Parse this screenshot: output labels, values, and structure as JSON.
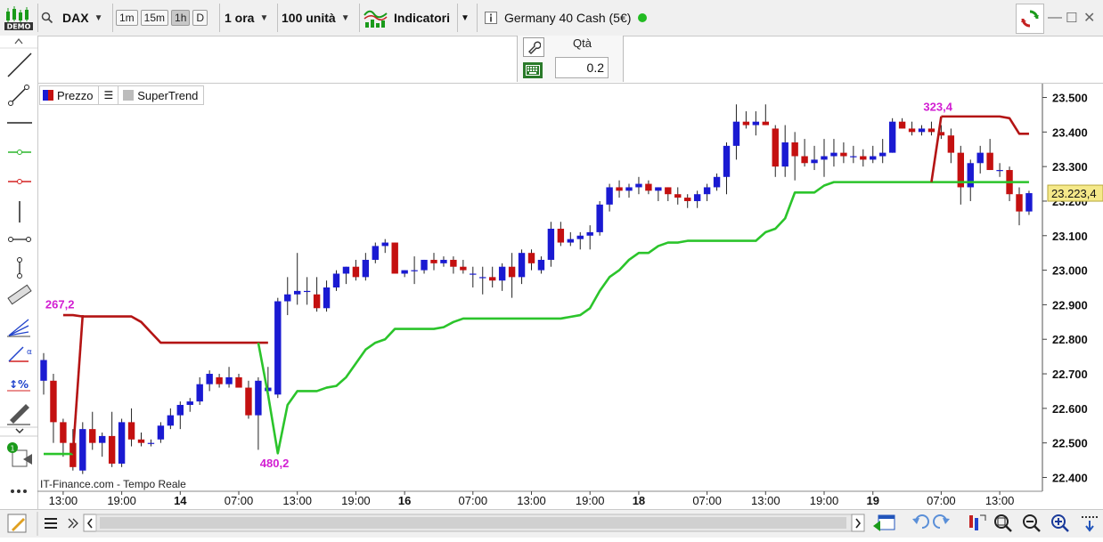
{
  "toolbar": {
    "demo_badge": "DEMO",
    "instrument": "DAX",
    "timeframes": [
      "1m",
      "15m",
      "1h",
      "D"
    ],
    "active_timeframe": "1h",
    "interval": "1 ora",
    "units": "100 unità",
    "indicators_label": "Indicatori",
    "market_name": "Germany 40 Cash (5€)",
    "status_color": "#22bb22"
  },
  "order_panel": {
    "qty_label": "Qtà",
    "qty_value": "0.2"
  },
  "legend": {
    "price_label": "Prezzo",
    "indicator_label": "SuperTrend"
  },
  "chart_data": {
    "type": "candlestick",
    "source_label": "IT-Finance.com - Tempo Reale",
    "y_ticks": [
      "23.500",
      "23.400",
      "23.300",
      "23.200",
      "23.100",
      "23.000",
      "22.900",
      "22.800",
      "22.700",
      "22.600",
      "22.500",
      "22.400"
    ],
    "ylim": [
      22360,
      23540
    ],
    "current_price": "23.223,4",
    "x_ticks": [
      {
        "label": "13:00",
        "bold": false,
        "i": 2
      },
      {
        "label": "19:00",
        "bold": false,
        "i": 8
      },
      {
        "label": "14",
        "bold": true,
        "i": 14
      },
      {
        "label": "07:00",
        "bold": false,
        "i": 20
      },
      {
        "label": "13:00",
        "bold": false,
        "i": 26
      },
      {
        "label": "19:00",
        "bold": false,
        "i": 32
      },
      {
        "label": "16",
        "bold": true,
        "i": 37
      },
      {
        "label": "07:00",
        "bold": false,
        "i": 44
      },
      {
        "label": "13:00",
        "bold": false,
        "i": 50
      },
      {
        "label": "19:00",
        "bold": false,
        "i": 56
      },
      {
        "label": "18",
        "bold": true,
        "i": 61
      },
      {
        "label": "07:00",
        "bold": false,
        "i": 68
      },
      {
        "label": "13:00",
        "bold": false,
        "i": 74
      },
      {
        "label": "19:00",
        "bold": false,
        "i": 80
      },
      {
        "label": "19",
        "bold": true,
        "i": 85
      },
      {
        "label": "07:00",
        "bold": false,
        "i": 92
      },
      {
        "label": "13:00",
        "bold": false,
        "i": 98
      }
    ],
    "candles": [
      [
        22680,
        22760,
        22640,
        22740
      ],
      [
        22680,
        22700,
        22500,
        22560
      ],
      [
        22560,
        22570,
        22460,
        22500
      ],
      [
        22500,
        22540,
        22420,
        22430
      ],
      [
        22420,
        22560,
        22410,
        22540
      ],
      [
        22540,
        22590,
        22480,
        22500
      ],
      [
        22500,
        22530,
        22460,
        22520
      ],
      [
        22520,
        22590,
        22430,
        22440
      ],
      [
        22440,
        22570,
        22430,
        22560
      ],
      [
        22560,
        22600,
        22490,
        22510
      ],
      [
        22510,
        22530,
        22490,
        22500
      ],
      [
        22500,
        22510,
        22490,
        22500
      ],
      [
        22510,
        22560,
        22500,
        22550
      ],
      [
        22550,
        22600,
        22540,
        22580
      ],
      [
        22580,
        22620,
        22540,
        22610
      ],
      [
        22610,
        22630,
        22590,
        22620
      ],
      [
        22620,
        22690,
        22610,
        22670
      ],
      [
        22670,
        22710,
        22650,
        22700
      ],
      [
        22690,
        22700,
        22660,
        22670
      ],
      [
        22670,
        22720,
        22660,
        22690
      ],
      [
        22690,
        22700,
        22660,
        22660
      ],
      [
        22660,
        22680,
        22570,
        22580
      ],
      [
        22580,
        22690,
        22480,
        22680
      ],
      [
        22650,
        22720,
        22640,
        22660
      ],
      [
        22640,
        22920,
        22630,
        22910
      ],
      [
        22910,
        22980,
        22870,
        22930
      ],
      [
        22930,
        23050,
        22900,
        22940
      ],
      [
        22940,
        22980,
        22900,
        22940
      ],
      [
        22930,
        22980,
        22880,
        22890
      ],
      [
        22890,
        22970,
        22880,
        22950
      ],
      [
        22950,
        23000,
        22940,
        22990
      ],
      [
        22990,
        23010,
        22960,
        23010
      ],
      [
        23010,
        23030,
        22970,
        22980
      ],
      [
        22980,
        23050,
        22970,
        23030
      ],
      [
        23030,
        23080,
        23020,
        23070
      ],
      [
        23070,
        23090,
        23050,
        23080
      ],
      [
        23080,
        23080,
        22990,
        22990
      ],
      [
        22990,
        23000,
        22980,
        23000
      ],
      [
        23000,
        23040,
        22960,
        23000
      ],
      [
        23000,
        23030,
        22990,
        23030
      ],
      [
        23030,
        23050,
        23000,
        23020
      ],
      [
        23020,
        23040,
        23010,
        23030
      ],
      [
        23030,
        23040,
        22990,
        23010
      ],
      [
        23010,
        23030,
        22990,
        23000
      ],
      [
        22990,
        23010,
        22950,
        22990
      ],
      [
        22980,
        23010,
        22930,
        22980
      ],
      [
        22980,
        23010,
        22950,
        22970
      ],
      [
        22970,
        23020,
        22940,
        23010
      ],
      [
        23010,
        23050,
        22920,
        22980
      ],
      [
        22980,
        23060,
        22960,
        23050
      ],
      [
        23050,
        23060,
        23000,
        23020
      ],
      [
        23000,
        23040,
        22990,
        23030
      ],
      [
        23030,
        23140,
        23010,
        23120
      ],
      [
        23120,
        23140,
        23070,
        23080
      ],
      [
        23080,
        23110,
        23070,
        23090
      ],
      [
        23090,
        23110,
        23060,
        23100
      ],
      [
        23100,
        23130,
        23060,
        23110
      ],
      [
        23110,
        23200,
        23100,
        23190
      ],
      [
        23190,
        23250,
        23170,
        23240
      ],
      [
        23240,
        23260,
        23210,
        23230
      ],
      [
        23230,
        23250,
        23210,
        23240
      ],
      [
        23240,
        23270,
        23220,
        23250
      ],
      [
        23250,
        23260,
        23220,
        23230
      ],
      [
        23230,
        23240,
        23200,
        23240
      ],
      [
        23240,
        23240,
        23200,
        23220
      ],
      [
        23220,
        23240,
        23190,
        23210
      ],
      [
        23210,
        23220,
        23180,
        23200
      ],
      [
        23200,
        23230,
        23180,
        23220
      ],
      [
        23220,
        23250,
        23200,
        23240
      ],
      [
        23240,
        23280,
        23230,
        23270
      ],
      [
        23270,
        23370,
        23220,
        23360
      ],
      [
        23360,
        23480,
        23320,
        23430
      ],
      [
        23430,
        23460,
        23410,
        23420
      ],
      [
        23420,
        23460,
        23390,
        23430
      ],
      [
        23430,
        23480,
        23420,
        23420
      ],
      [
        23410,
        23420,
        23270,
        23300
      ],
      [
        23300,
        23420,
        23270,
        23370
      ],
      [
        23370,
        23400,
        23260,
        23330
      ],
      [
        23330,
        23380,
        23300,
        23310
      ],
      [
        23310,
        23360,
        23290,
        23320
      ],
      [
        23320,
        23380,
        23270,
        23330
      ],
      [
        23330,
        23380,
        23300,
        23340
      ],
      [
        23340,
        23370,
        23310,
        23330
      ],
      [
        23330,
        23360,
        23310,
        23330
      ],
      [
        23330,
        23350,
        23300,
        23320
      ],
      [
        23320,
        23360,
        23310,
        23330
      ],
      [
        23330,
        23380,
        23310,
        23340
      ],
      [
        23340,
        23440,
        23340,
        23430
      ],
      [
        23430,
        23440,
        23410,
        23410
      ],
      [
        23410,
        23430,
        23390,
        23400
      ],
      [
        23400,
        23420,
        23390,
        23410
      ],
      [
        23410,
        23430,
        23390,
        23400
      ],
      [
        23400,
        23420,
        23380,
        23390
      ],
      [
        23390,
        23410,
        23310,
        23340
      ],
      [
        23340,
        23360,
        23190,
        23240
      ],
      [
        23240,
        23320,
        23200,
        23310
      ],
      [
        23310,
        23360,
        23280,
        23340
      ],
      [
        23340,
        23380,
        23290,
        23290
      ],
      [
        23290,
        23310,
        23270,
        23290
      ],
      [
        23290,
        23300,
        23200,
        23220
      ],
      [
        23220,
        23240,
        23130,
        23170
      ],
      [
        23170,
        23230,
        23160,
        23223
      ]
    ],
    "supertrend": {
      "upper": [
        [
          2,
          22870
        ],
        [
          3,
          22870
        ],
        [
          4,
          22866
        ],
        [
          5,
          22866
        ],
        [
          6,
          22866
        ],
        [
          7,
          22866
        ],
        [
          8,
          22866
        ],
        [
          9,
          22866
        ],
        [
          10,
          22850
        ],
        [
          11,
          22820
        ],
        [
          12,
          22790
        ],
        [
          13,
          22790
        ],
        [
          14,
          22790
        ],
        [
          15,
          22790
        ],
        [
          16,
          22790
        ],
        [
          17,
          22790
        ],
        [
          18,
          22790
        ],
        [
          19,
          22790
        ],
        [
          20,
          22790
        ],
        [
          21,
          22790
        ],
        [
          22,
          22790
        ],
        [
          23,
          22790
        ]
      ],
      "upper2": [
        [
          92,
          23445
        ],
        [
          93,
          23445
        ],
        [
          94,
          23445
        ],
        [
          95,
          23445
        ],
        [
          96,
          23445
        ],
        [
          97,
          23445
        ],
        [
          98,
          23445
        ],
        [
          99,
          23440
        ],
        [
          100,
          23395
        ],
        [
          101,
          23395
        ]
      ],
      "lower": [
        [
          0,
          22468
        ],
        [
          1,
          22468
        ],
        [
          2,
          22468
        ],
        [
          3,
          22468
        ]
      ],
      "lower2": [
        [
          23,
          22640
        ],
        [
          24,
          22470
        ],
        [
          25,
          22610
        ],
        [
          26,
          22650
        ],
        [
          27,
          22650
        ],
        [
          28,
          22650
        ],
        [
          29,
          22660
        ],
        [
          30,
          22665
        ],
        [
          31,
          22690
        ],
        [
          32,
          22730
        ],
        [
          33,
          22770
        ],
        [
          34,
          22790
        ],
        [
          35,
          22800
        ],
        [
          36,
          22830
        ],
        [
          37,
          22830
        ],
        [
          38,
          22830
        ],
        [
          39,
          22830
        ],
        [
          40,
          22830
        ],
        [
          41,
          22835
        ],
        [
          42,
          22850
        ],
        [
          43,
          22860
        ],
        [
          44,
          22860
        ],
        [
          45,
          22860
        ],
        [
          46,
          22860
        ],
        [
          47,
          22860
        ],
        [
          48,
          22860
        ],
        [
          49,
          22860
        ],
        [
          50,
          22860
        ],
        [
          51,
          22860
        ],
        [
          52,
          22860
        ],
        [
          53,
          22860
        ],
        [
          54,
          22865
        ],
        [
          55,
          22870
        ],
        [
          56,
          22890
        ],
        [
          57,
          22940
        ],
        [
          58,
          22980
        ],
        [
          59,
          23000
        ],
        [
          60,
          23030
        ],
        [
          61,
          23050
        ],
        [
          62,
          23050
        ],
        [
          63,
          23070
        ],
        [
          64,
          23080
        ],
        [
          65,
          23080
        ],
        [
          66,
          23085
        ],
        [
          67,
          23085
        ],
        [
          68,
          23085
        ],
        [
          69,
          23085
        ],
        [
          70,
          23085
        ],
        [
          71,
          23085
        ],
        [
          72,
          23085
        ],
        [
          73,
          23085
        ],
        [
          74,
          23110
        ],
        [
          75,
          23120
        ],
        [
          76,
          23150
        ],
        [
          77,
          23225
        ],
        [
          78,
          23225
        ],
        [
          79,
          23225
        ],
        [
          80,
          23245
        ],
        [
          81,
          23255
        ],
        [
          82,
          23255
        ],
        [
          83,
          23255
        ],
        [
          84,
          23255
        ],
        [
          85,
          23255
        ],
        [
          86,
          23255
        ],
        [
          87,
          23255
        ],
        [
          88,
          23255
        ],
        [
          89,
          23255
        ],
        [
          90,
          23255
        ],
        [
          91,
          23255
        ],
        [
          92,
          23255
        ],
        [
          93,
          23255
        ],
        [
          94,
          23255
        ],
        [
          95,
          23255
        ],
        [
          96,
          23255
        ],
        [
          97,
          23255
        ],
        [
          98,
          23255
        ],
        [
          99,
          23255
        ],
        [
          100,
          23255
        ],
        [
          101,
          23255
        ]
      ],
      "annotations": [
        {
          "text": "267,2",
          "i": 2,
          "y": 22890,
          "color": "#d21ed2"
        },
        {
          "text": "480,2",
          "i": 24,
          "y": 22430,
          "color": "#d21ed2"
        },
        {
          "text": "323,4",
          "i": 92,
          "y": 23462,
          "color": "#d21ed2"
        }
      ],
      "colors": {
        "bear": "#c41010",
        "bull": "#1a1ad2",
        "st_up": "#2bc42b",
        "st_down": "#b41414",
        "label": "#d21ed2"
      }
    }
  }
}
